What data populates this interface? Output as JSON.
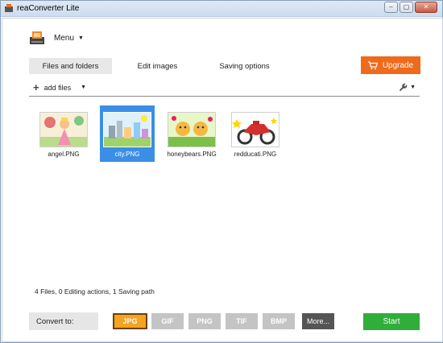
{
  "window": {
    "title": "reaConverter Lite",
    "minimize_glyph": "–",
    "maximize_glyph": "▢",
    "close_glyph": "✕"
  },
  "menu": {
    "label": "Menu"
  },
  "tabs": [
    {
      "label": "Files and folders",
      "active": true
    },
    {
      "label": "Edit images",
      "active": false
    },
    {
      "label": "Saving options",
      "active": false
    }
  ],
  "upgrade": {
    "label": "Upgrade",
    "color": "#ef6a1c"
  },
  "toolbar": {
    "add_files_label": "add files",
    "wrench_icon": "wrench-icon"
  },
  "files": [
    {
      "name": "angel.PNG",
      "selected": false
    },
    {
      "name": "city.PNG",
      "selected": true
    },
    {
      "name": "honeybears.PNG",
      "selected": false
    },
    {
      "name": "redducati.PNG",
      "selected": false
    }
  ],
  "status": "4 Files, 0 Editing actions, 1 Saving path",
  "convert": {
    "label": "Convert to:",
    "formats": [
      "JPG",
      "GIF",
      "PNG",
      "TIF",
      "BMP"
    ],
    "selected_format": "JPG",
    "more_label": "More...",
    "start_label": "Start",
    "start_color": "#2fae3a"
  }
}
